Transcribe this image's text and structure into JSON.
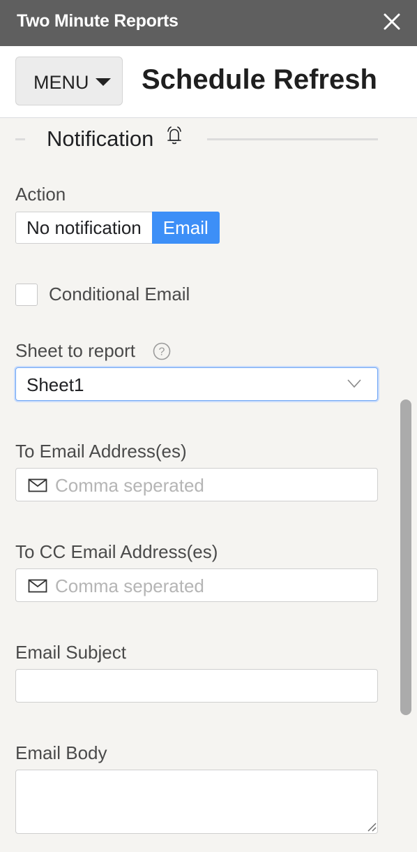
{
  "window": {
    "title": "Two Minute Reports"
  },
  "header": {
    "menu_label": "MENU",
    "page_title": "Schedule Refresh"
  },
  "section": {
    "title": "Notification"
  },
  "action": {
    "label": "Action",
    "options": [
      "No notification",
      "Email"
    ],
    "selected": "Email"
  },
  "conditional_email": {
    "label": "Conditional Email",
    "checked": false
  },
  "sheet": {
    "label": "Sheet to report",
    "help": "?",
    "value": "Sheet1"
  },
  "to_email": {
    "label": "To Email Address(es)",
    "placeholder": "Comma seperated"
  },
  "cc_email": {
    "label": "To CC Email Address(es)",
    "placeholder": "Comma seperated"
  },
  "subject": {
    "label": "Email Subject",
    "value": ""
  },
  "body": {
    "label": "Email Body",
    "value": ""
  },
  "colors": {
    "titlebar": "#5f5f5f",
    "accent": "#3d8ff7",
    "background": "#f5f4f1"
  }
}
